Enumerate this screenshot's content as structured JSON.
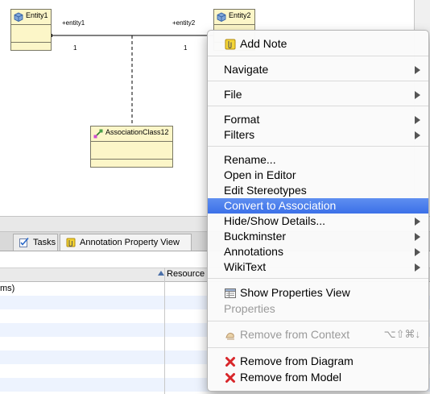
{
  "diagram": {
    "entity1": {
      "name": "Entity1"
    },
    "entity2": {
      "name": "Entity2"
    },
    "association_class": {
      "name": "AssociationClass12"
    },
    "role_left": "+entity1",
    "role_right": "+entity2",
    "mult_left": "1",
    "mult_right": "1"
  },
  "bottom_panel": {
    "tabs": [
      {
        "label": "Tasks",
        "icon": "tasks-icon"
      },
      {
        "label": "Annotation Property View",
        "icon": "annotation-icon"
      }
    ],
    "columns": [
      "Resource"
    ],
    "rows": [
      "ms)"
    ]
  },
  "context_menu": {
    "items": [
      {
        "label": "Add Note",
        "icon": "note-icon"
      },
      {
        "label": "Navigate"
      },
      {
        "label": "File"
      },
      {
        "label": "Format"
      },
      {
        "label": "Filters"
      },
      {
        "label": "Rename..."
      },
      {
        "label": "Open in Editor"
      },
      {
        "label": "Edit Stereotypes"
      },
      {
        "label": "Convert to Association"
      },
      {
        "label": "Hide/Show Details..."
      },
      {
        "label": "Buckminster"
      },
      {
        "label": "Annotations"
      },
      {
        "label": "WikiText"
      },
      {
        "label": "Show Properties View",
        "icon": "properties-icon"
      },
      {
        "label": "Properties"
      },
      {
        "label": "Remove from Context",
        "icon": "remove-context-icon",
        "shortcut": "⌥⇧⌘↓"
      },
      {
        "label": "Remove from Diagram",
        "icon": "red-x-icon"
      },
      {
        "label": "Remove from Model",
        "icon": "red-x-icon"
      }
    ],
    "highlight_color": "#3b70e8"
  }
}
